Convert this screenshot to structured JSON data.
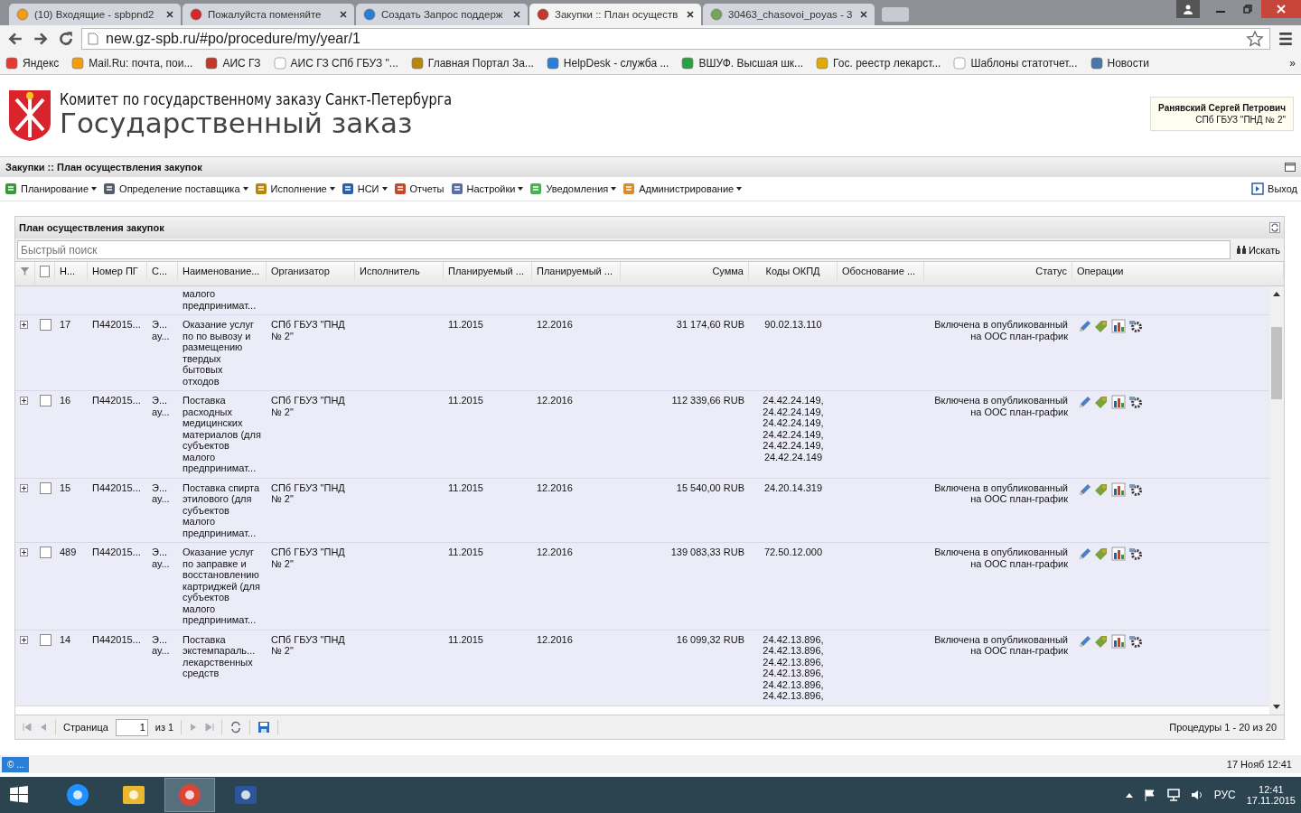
{
  "browser": {
    "tabs": [
      {
        "title": "(10) Входящие - spbpnd2",
        "selected": false
      },
      {
        "title": "Пожалуйста поменяйте",
        "selected": false
      },
      {
        "title": "Создать Запрос поддерж",
        "selected": false
      },
      {
        "title": "Закупки :: План осуществ",
        "selected": true
      },
      {
        "title": "30463_chasovoi_poyas - 3",
        "selected": false
      }
    ],
    "address": "new.gz-spb.ru/#po/procedure/my/year/1",
    "bookmarks": [
      "Яндекс",
      "Mail.Ru: почта, пои...",
      "АИС ГЗ",
      "АИС ГЗ СПб ГБУЗ \"...",
      "Главная Портал За...",
      "HelpDesk - служба ...",
      "ВШУФ. Высшая шк...",
      "Гос. реестр лекарст...",
      "Шаблоны статотчет...",
      "Новости"
    ],
    "bookmarks_more": "»"
  },
  "header": {
    "subtitle": "Комитет по государственному заказу Санкт-Петербурга",
    "title": "Государственный заказ",
    "user_name": "Ранявский Сергей Петрович",
    "user_org": "СПб ГБУЗ \"ПНД № 2\""
  },
  "app_title": "Закупки :: План осуществления закупок",
  "menu": [
    {
      "label": "Планирование",
      "dropdown": true
    },
    {
      "label": "Определение поставщика",
      "dropdown": true
    },
    {
      "label": "Исполнение",
      "dropdown": true
    },
    {
      "label": "НСИ",
      "dropdown": true
    },
    {
      "label": "Отчеты",
      "dropdown": false
    },
    {
      "label": "Настройки",
      "dropdown": true
    },
    {
      "label": "Уведомления",
      "dropdown": true
    },
    {
      "label": "Администрирование",
      "dropdown": true
    }
  ],
  "logout": "Выход",
  "panel": {
    "title": "План осуществления закупок",
    "search": {
      "placeholder": "Быстрый поиск"
    },
    "search_button": "Искать",
    "select_all": false,
    "columns": [
      "Н...",
      "Номер ПГ",
      "С...",
      "Наименование...",
      "Организатор",
      "Исполнитель",
      "Планируемый ...",
      "Планируемый ...",
      "Сумма",
      "Коды ОКПД",
      "Обоснование ...",
      "Статус",
      "Операции"
    ],
    "rows": [
      {
        "kind": "partial",
        "name": "малого предпринимат..."
      },
      {
        "kind": "procedure",
        "expanded": false,
        "checked": false,
        "n": "17",
        "number": "П442015...",
        "method": "Э... ау...",
        "name": "Оказание услуг по по вывозу и размещению твердых бытовых отходов",
        "organizer": "СПб ГБУЗ \"ПНД № 2\"",
        "start": "11.2015",
        "end": "12.2016",
        "sum": "31 174,60 RUB",
        "okpd": [
          "90.02.13.110"
        ],
        "status": "Включена в опубликованный на ООС план-график"
      },
      {
        "kind": "procedure",
        "expanded": false,
        "checked": false,
        "n": "16",
        "number": "П442015...",
        "method": "Э... ау...",
        "name": "Поставка расходных медицинских материалов (для субъектов малого предпринимат...",
        "organizer": "СПб ГБУЗ \"ПНД № 2\"",
        "start": "11.2015",
        "end": "12.2016",
        "sum": "112 339,66 RUB",
        "okpd": [
          "24.42.24.149,",
          "24.42.24.149,",
          "24.42.24.149,",
          "24.42.24.149,",
          "24.42.24.149,",
          "24.42.24.149"
        ],
        "status": "Включена в опубликованный на ООС план-график"
      },
      {
        "kind": "procedure",
        "expanded": false,
        "checked": false,
        "n": "15",
        "number": "П442015...",
        "method": "Э... ау...",
        "name": "Поставка спирта этилового (для субъектов малого предпринимат...",
        "organizer": "СПб ГБУЗ \"ПНД № 2\"",
        "start": "11.2015",
        "end": "12.2016",
        "sum": "15 540,00 RUB",
        "okpd": [
          "24.20.14.319"
        ],
        "status": "Включена в опубликованный на ООС план-график"
      },
      {
        "kind": "procedure",
        "expanded": false,
        "checked": false,
        "n": "489",
        "number": "П442015...",
        "method": "Э... ау...",
        "name": "Оказание услуг по заправке и восстановлению картриджей (для субъектов малого предпринимат...",
        "organizer": "СПб ГБУЗ \"ПНД № 2\"",
        "start": "11.2015",
        "end": "12.2016",
        "sum": "139 083,33 RUB",
        "okpd": [
          "72.50.12.000"
        ],
        "status": "Включена в опубликованный на ООС план-график"
      },
      {
        "kind": "procedure",
        "expanded": false,
        "checked": false,
        "n": "14",
        "number": "П442015...",
        "method": "Э... ау...",
        "name": "Поставка экстемпараль... лекарственных средств",
        "organizer": "СПб ГБУЗ \"ПНД № 2\"",
        "start": "11.2015",
        "end": "12.2016",
        "sum": "16 099,32 RUB",
        "okpd": [
          "24.42.13.896,",
          "24.42.13.896,",
          "24.42.13.896,",
          "24.42.13.896,",
          "24.42.13.896,",
          "24.42.13.896,"
        ],
        "status": "Включена в опубликованный на ООС план-график"
      }
    ],
    "pager": {
      "page_label": "Страница",
      "page": "1",
      "of": "из 1",
      "summary": "Процедуры 1 - 20 из 20"
    }
  },
  "status_bar": {
    "button": "© ...",
    "datetime": "17 Нояб 12:41"
  },
  "taskbar": {
    "apps": [
      {
        "selected": false
      },
      {
        "selected": false
      },
      {
        "selected": true
      },
      {
        "selected": false
      }
    ],
    "language": "РУС",
    "time": "12:41",
    "date": "17.11.2015"
  }
}
